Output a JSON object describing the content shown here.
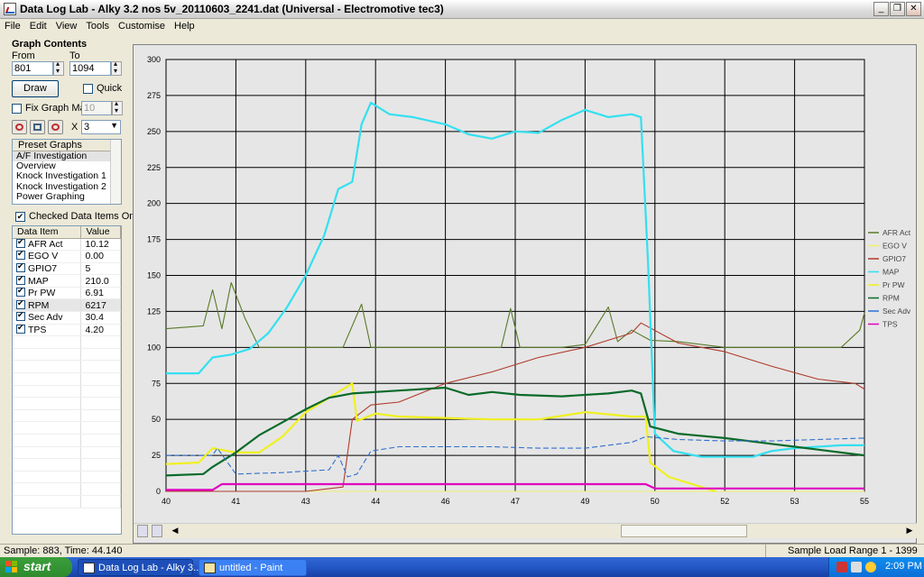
{
  "window": {
    "title": "Data Log Lab - Alky 3.2 nos 5v_20110603_2241.dat (Universal - Electromotive tec3)",
    "minimize_label": "_",
    "maximize_label": "❐",
    "close_label": "✕"
  },
  "menu": [
    "File",
    "Edit",
    "View",
    "Tools",
    "Customise",
    "Help"
  ],
  "graph_contents": {
    "heading": "Graph Contents",
    "from_label": "From",
    "to_label": "To",
    "from_value": "801",
    "to_value": "1094",
    "draw_label": "Draw",
    "quick_label": "Quick",
    "fix_graph_max_label": "Fix Graph Max",
    "fix_graph_max_value": "10",
    "multiplier_label": "X",
    "multiplier_value": "3"
  },
  "preset_graphs": {
    "header": "Preset Graphs",
    "items": [
      "A/F Investigation",
      "Overview",
      "Knock Investigation 1",
      "Knock Investigation 2",
      "Power Graphing"
    ],
    "selected_index": 0
  },
  "checked_only_label": "Checked Data Items Only",
  "data_items": {
    "col_item": "Data Item",
    "col_value": "Value",
    "rows": [
      {
        "name": "AFR Act",
        "value": "10.12"
      },
      {
        "name": "EGO V",
        "value": "0.00"
      },
      {
        "name": "GPIO7",
        "value": "5"
      },
      {
        "name": "MAP",
        "value": "210.0"
      },
      {
        "name": "Pr PW",
        "value": "6.91"
      },
      {
        "name": "RPM",
        "value": "6217"
      },
      {
        "name": "Sec Adv",
        "value": "30.4"
      },
      {
        "name": "TPS",
        "value": "4.20"
      }
    ],
    "highlight_index": 5
  },
  "status": {
    "left": "Sample: 883, Time: 44.140",
    "right": "Sample Load Range 1 - 1399"
  },
  "taskbar": {
    "start_label": "start",
    "tasks": [
      "Data Log Lab - Alky 3...",
      "untitled - Paint"
    ],
    "clock": "2:09 PM"
  },
  "chart_data": {
    "type": "line",
    "x_ticks": [
      "40",
      "41",
      "43",
      "44",
      "46",
      "47",
      "49",
      "50",
      "52",
      "53",
      "55"
    ],
    "x_range": [
      40,
      55
    ],
    "ylim": [
      0,
      300
    ],
    "y_ticks": [
      0,
      25,
      50,
      75,
      100,
      125,
      150,
      175,
      200,
      225,
      250,
      275,
      300
    ],
    "grid": true,
    "legend_position": "right",
    "colors": {
      "AFR Act": "#5a7a2a",
      "EGO V": "#f0f070",
      "GPIO7": "#b03a2a",
      "MAP": "#33e0f0",
      "Pr PW": "#f0f020",
      "RPM": "#0a6a2a",
      "Sec Adv": "#3070d0",
      "TPS": "#e000c0"
    },
    "series": [
      {
        "name": "AFR Act",
        "x": [
          40.0,
          40.8,
          41.0,
          41.2,
          41.4,
          41.7,
          42.0,
          42.6,
          43.0,
          43.8,
          44.2,
          44.4,
          44.6,
          45.5,
          46.5,
          47.2,
          47.4,
          47.6,
          48.5,
          49.0,
          49.5,
          49.7,
          50.0,
          50.4,
          51.0,
          52.0,
          53.0,
          54.5,
          54.9,
          55.0
        ],
        "y": [
          113,
          115,
          140,
          113,
          145,
          120,
          100,
          100,
          100,
          100,
          130,
          100,
          100,
          100,
          100,
          100,
          127,
          100,
          100,
          102,
          128,
          104,
          112,
          105,
          104,
          100,
          100,
          100,
          112,
          124
        ]
      },
      {
        "name": "EGO V",
        "x": [
          40.0,
          55.0
        ],
        "y": [
          0,
          0
        ]
      },
      {
        "name": "GPIO7",
        "x": [
          40.0,
          42.5,
          43.0,
          43.8,
          44.0,
          44.4,
          45.0,
          46.0,
          47.0,
          48.0,
          49.0,
          50.0,
          50.2,
          51.0,
          52.0,
          53.0,
          54.0,
          54.8,
          55.0
        ],
        "y": [
          0,
          0,
          0,
          3,
          50,
          60,
          62,
          75,
          83,
          93,
          100,
          110,
          117,
          103,
          97,
          87,
          78,
          75,
          71
        ]
      },
      {
        "name": "MAP",
        "x": [
          40.0,
          40.7,
          41.0,
          41.4,
          41.8,
          42.2,
          42.6,
          43.0,
          43.4,
          43.7,
          44.0,
          44.2,
          44.4,
          44.8,
          45.3,
          46.0,
          46.5,
          47.0,
          47.5,
          48.0,
          48.5,
          49.0,
          49.5,
          50.0,
          50.2,
          50.35,
          50.5,
          50.9,
          51.5,
          52.0,
          52.6,
          53.0,
          53.5,
          54.5,
          55.0
        ],
        "y": [
          82,
          82,
          93,
          95,
          99,
          110,
          128,
          150,
          178,
          210,
          215,
          255,
          270,
          262,
          260,
          255,
          248,
          245,
          250,
          249,
          258,
          265,
          260,
          262,
          260,
          160,
          40,
          28,
          24,
          24,
          24,
          28,
          30,
          32,
          32
        ]
      },
      {
        "name": "Pr PW",
        "x": [
          40.0,
          40.7,
          41.0,
          41.5,
          42.0,
          42.5,
          43.0,
          43.5,
          44.0,
          44.1,
          44.5,
          45.0,
          46.0,
          47.0,
          48.0,
          49.0,
          50.0,
          50.3,
          50.4,
          50.8,
          51.3,
          51.8
        ],
        "y": [
          19,
          20,
          30,
          27,
          27,
          38,
          55,
          65,
          75,
          49,
          54,
          52,
          51,
          50,
          50,
          55,
          52,
          52,
          20,
          10,
          5,
          0
        ]
      },
      {
        "name": "RPM",
        "x": [
          40.0,
          40.8,
          41.0,
          41.5,
          42.0,
          42.5,
          43.0,
          43.5,
          44.0,
          45.0,
          46.0,
          46.5,
          47.0,
          47.6,
          48.5,
          49.5,
          50.0,
          50.2,
          50.4,
          51.0,
          52.0,
          53.0,
          54.0,
          55.0
        ],
        "y": [
          11,
          12,
          17,
          27,
          39,
          48,
          57,
          65,
          68,
          70,
          72,
          67,
          69,
          67,
          66,
          68,
          70,
          68,
          45,
          40,
          37,
          33,
          29,
          25
        ]
      },
      {
        "name": "Sec Adv",
        "x": [
          40.0,
          41.0,
          41.1,
          41.5,
          42.5,
          43.0,
          43.5,
          43.7,
          43.9,
          44.1,
          44.4,
          45.0,
          46.0,
          47.0,
          48.0,
          49.0,
          50.0,
          50.3,
          51.0,
          52.0,
          53.0,
          54.0,
          55.0
        ],
        "y": [
          25,
          25,
          30,
          12,
          13,
          14,
          15,
          25,
          10,
          12,
          28,
          31,
          31,
          31,
          30,
          30,
          34,
          38,
          36,
          35,
          35,
          36,
          37
        ]
      },
      {
        "name": "TPS",
        "x": [
          40.0,
          41.0,
          41.2,
          50.3,
          50.5,
          55.0
        ],
        "y": [
          1,
          1,
          5,
          5,
          2,
          2
        ]
      }
    ]
  }
}
